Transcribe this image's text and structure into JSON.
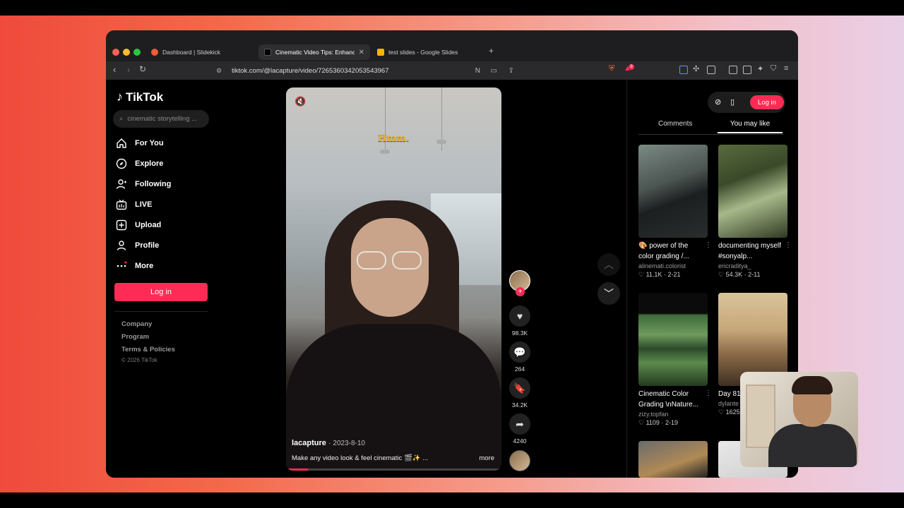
{
  "browser": {
    "tabs": [
      {
        "label": "Dashboard | Slidekick",
        "active": false
      },
      {
        "label": "Cinematic Video Tips: Enhance",
        "active": true
      },
      {
        "label": "test slides - Google Slides",
        "active": false
      }
    ],
    "new_tab": "+",
    "url": "tiktok.com/@lacapture/video/7265360342053543967",
    "extension_badge": "9"
  },
  "sidebar": {
    "logo": "TikTok",
    "search_placeholder": "cinematic storytelling ...",
    "nav": [
      {
        "label": "For You",
        "icon": "home-icon"
      },
      {
        "label": "Explore",
        "icon": "compass-icon"
      },
      {
        "label": "Following",
        "icon": "following-icon"
      },
      {
        "label": "LIVE",
        "icon": "live-icon"
      },
      {
        "label": "Upload",
        "icon": "upload-icon"
      },
      {
        "label": "Profile",
        "icon": "profile-icon"
      },
      {
        "label": "More",
        "icon": "more-icon"
      }
    ],
    "login": "Log in",
    "footer": [
      "Company",
      "Program",
      "Terms & Policies",
      "© 2026 TikTok"
    ]
  },
  "video": {
    "caption_overlay": "Hmm.",
    "username": "lacapture",
    "date": "2023-8-10",
    "separator": "·",
    "description": "Make any video look & feel cinematic 🎬✨ ...",
    "more": "more",
    "progress": 0.1
  },
  "actions": {
    "likes": "98.3K",
    "comments": "264",
    "saves": "34.2K",
    "shares": "4240"
  },
  "right_panel": {
    "login": "Log in",
    "tabs": [
      "Comments",
      "You may like"
    ],
    "active_tab": "You may like",
    "cards": [
      {
        "title": "🎨 power of the color grading /...",
        "user": "alinemati.colorist",
        "likes": "11.1K",
        "date": "2-21"
      },
      {
        "title": "documenting myself #sonyalp...",
        "user": "ericraditya_",
        "likes": "54.3K",
        "date": "2-11"
      },
      {
        "title": "Cinematic Color Grading \\nNature...",
        "user": "zizy.topfan",
        "likes": "1109",
        "date": "2-19"
      },
      {
        "title": "Day 81 color g",
        "user": "dylante",
        "likes": "1625",
        "date": ""
      }
    ]
  },
  "colors": {
    "accent": "#fe2c55",
    "background": "#000000"
  }
}
